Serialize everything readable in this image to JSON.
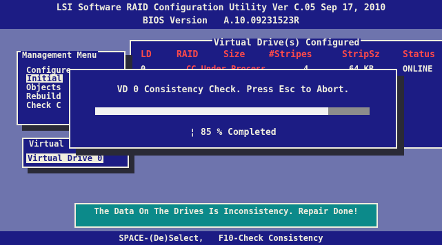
{
  "window": {
    "title": "LSI Software RAID Configuration Utility Ver C.05 Sep 17, 2010",
    "bios_version": "BIOS Version   A.10.09231523R"
  },
  "management_menu": {
    "title": "Management Menu",
    "items": [
      "Configure",
      "Initial",
      "Objects",
      "Rebuild",
      "Check C"
    ]
  },
  "configured_table": {
    "title": "Virtual Drive(s) Configured",
    "columns": [
      "LD",
      "RAID",
      "Size",
      "#Stripes",
      "StripSz",
      "Status"
    ],
    "row": {
      "ld": "0",
      "process": "CC Under Process",
      "stripes": "4",
      "stripsz": "64 KB",
      "status": "ONLINE"
    }
  },
  "virtual_drives": {
    "title": "Virtual Drives",
    "items": [
      "Virtual Drive 0"
    ]
  },
  "dialog": {
    "message": "VD 0 Consistency Check. Press Esc to Abort.",
    "progress_percent": 85,
    "progress_text": "¦ 85 % Completed"
  },
  "bottom_message": {
    "text": "The Data On The Drives Is Inconsistency. Repair Done!"
  },
  "status_bar": {
    "text": "SPACE-(De)Select,   F10-Check Consistency"
  },
  "colors": {
    "background": "#6e74ad",
    "panel": "#1c1c84",
    "text": "#f0eede",
    "header": "#ff4a4a",
    "message_box": "#0c8a8a"
  }
}
